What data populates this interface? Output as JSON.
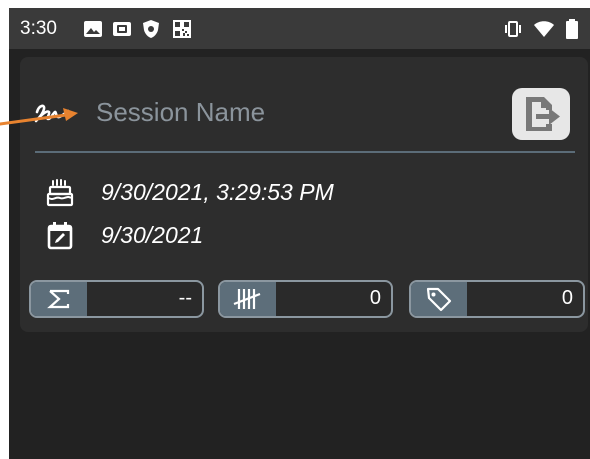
{
  "status_bar": {
    "time": "3:30",
    "left_icons": [
      "image-icon",
      "sd-card-icon",
      "shield-icon",
      "qr-code-icon"
    ],
    "right_icons": [
      "vibrate-icon",
      "wifi-icon",
      "battery-icon"
    ]
  },
  "session": {
    "name_value": "",
    "name_placeholder": "Session Name",
    "created": "9/30/2021, 3:29:53 PM",
    "date": "9/30/2021"
  },
  "stats": {
    "sum_value": "--",
    "count_value": "0",
    "tags_value": "0"
  },
  "colors": {
    "accent": "#5d6e7a",
    "annotation_arrow": "#e8832f",
    "card_background": "#2d2d2d",
    "app_background": "#222222"
  }
}
